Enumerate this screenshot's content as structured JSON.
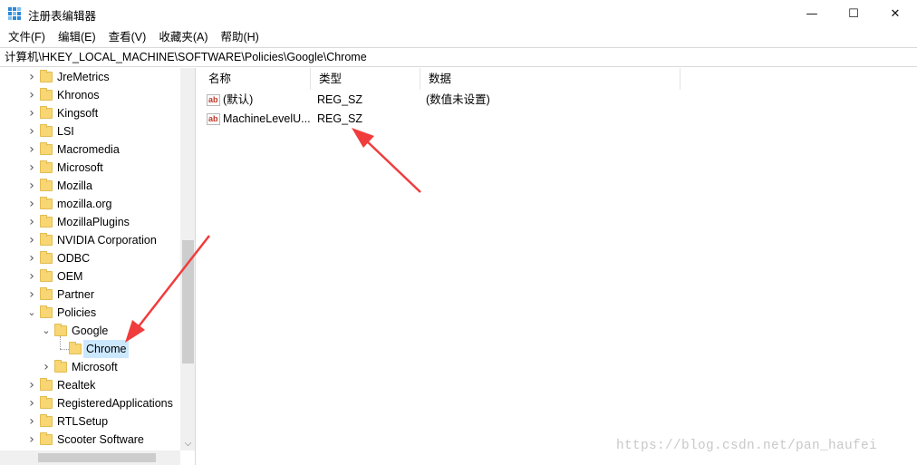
{
  "window": {
    "title": "注册表编辑器",
    "icon": "regedit-icon",
    "controls": {
      "minimize": "—",
      "maximize": "☐",
      "close": "✕"
    }
  },
  "menubar": {
    "items": [
      {
        "label": "文件(F)"
      },
      {
        "label": "编辑(E)"
      },
      {
        "label": "查看(V)"
      },
      {
        "label": "收藏夹(A)"
      },
      {
        "label": "帮助(H)"
      }
    ]
  },
  "address": {
    "path": "计算机\\HKEY_LOCAL_MACHINE\\SOFTWARE\\Policies\\Google\\Chrome"
  },
  "tree": {
    "items": [
      {
        "label": "JreMetrics",
        "level": 0,
        "expander": "collapsed"
      },
      {
        "label": "Khronos",
        "level": 0,
        "expander": "collapsed"
      },
      {
        "label": "Kingsoft",
        "level": 0,
        "expander": "collapsed"
      },
      {
        "label": "LSI",
        "level": 0,
        "expander": "collapsed"
      },
      {
        "label": "Macromedia",
        "level": 0,
        "expander": "collapsed"
      },
      {
        "label": "Microsoft",
        "level": 0,
        "expander": "collapsed"
      },
      {
        "label": "Mozilla",
        "level": 0,
        "expander": "collapsed"
      },
      {
        "label": "mozilla.org",
        "level": 0,
        "expander": "collapsed"
      },
      {
        "label": "MozillaPlugins",
        "level": 0,
        "expander": "collapsed"
      },
      {
        "label": "NVIDIA Corporation",
        "level": 0,
        "expander": "collapsed"
      },
      {
        "label": "ODBC",
        "level": 0,
        "expander": "collapsed"
      },
      {
        "label": "OEM",
        "level": 0,
        "expander": "collapsed"
      },
      {
        "label": "Partner",
        "level": 0,
        "expander": "collapsed"
      },
      {
        "label": "Policies",
        "level": 0,
        "expander": "expanded"
      },
      {
        "label": "Google",
        "level": 1,
        "expander": "expanded"
      },
      {
        "label": "Chrome",
        "level": 2,
        "expander": "none",
        "selected": true
      },
      {
        "label": "Microsoft",
        "level": 1,
        "expander": "collapsed"
      },
      {
        "label": "Realtek",
        "level": 0,
        "expander": "collapsed"
      },
      {
        "label": "RegisteredApplications",
        "level": 0,
        "expander": "collapsed"
      },
      {
        "label": "RTLSetup",
        "level": 0,
        "expander": "collapsed"
      },
      {
        "label": "Scooter Software",
        "level": 0,
        "expander": "collapsed"
      }
    ]
  },
  "list": {
    "columns": [
      "名称",
      "类型",
      "数据"
    ],
    "rows": [
      {
        "name": "(默认)",
        "type": "REG_SZ",
        "data": "(数值未设置)",
        "icon": "string-value-icon"
      },
      {
        "name": "MachineLevelU...",
        "type": "REG_SZ",
        "data": "",
        "icon": "string-value-icon"
      }
    ]
  },
  "watermark": "https://blog.csdn.net/pan_haufei",
  "colors": {
    "selection": "#cce8ff",
    "annotation_arrow": "#f03c3c",
    "folder": "#f7d673"
  }
}
